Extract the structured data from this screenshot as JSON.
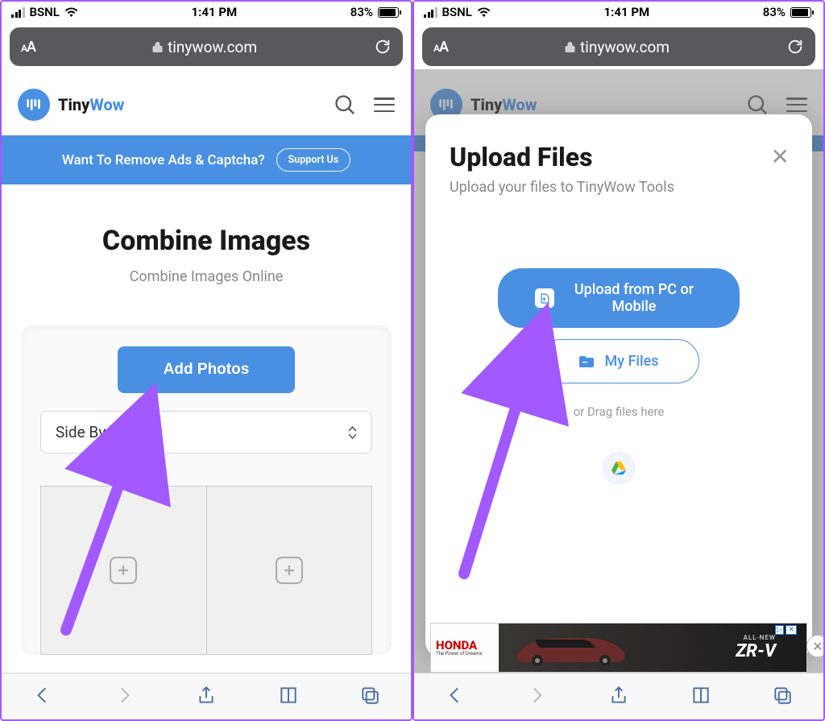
{
  "status": {
    "carrier": "BSNL",
    "time": "1:41 PM",
    "battery_pct": "83%"
  },
  "urlbar": {
    "aa": "AA",
    "domain": "tinywow.com"
  },
  "brand": {
    "tiny": "Tiny",
    "wow": "Wow"
  },
  "banner": {
    "text": "Want To Remove Ads & Captcha?",
    "cta": "Support Us"
  },
  "left": {
    "title": "Combine Images",
    "subtitle": "Combine Images Online",
    "add_photos": "Add Photos",
    "layout_option": "Side By Side"
  },
  "right": {
    "modal_title": "Upload Files",
    "modal_sub": "Upload your files to TinyWow Tools",
    "upload_btn": "Upload from PC or Mobile",
    "myfiles_btn": "My Files",
    "drag_text": "or Drag files here"
  },
  "ad": {
    "brand": "HONDA",
    "tag": "The Power of Dreams",
    "line1": "ALL-NEW",
    "model": "ZR-V"
  }
}
